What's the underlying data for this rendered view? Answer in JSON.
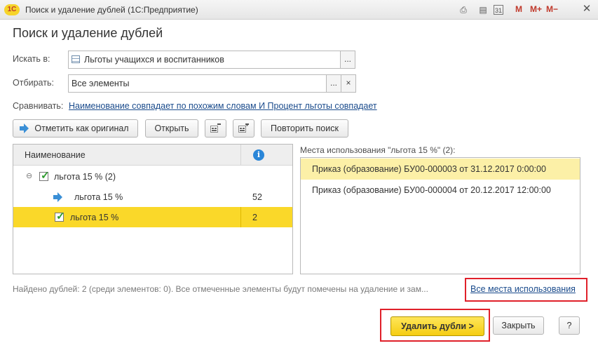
{
  "window": {
    "title": "Поиск и удаление дублей  (1С:Предприятие)",
    "logo_text": "1С"
  },
  "titlebar_tools": {
    "m": "M",
    "m_plus": "M+",
    "m_minus": "M−",
    "calendar": "31",
    "close": "✕"
  },
  "heading": "Поиск и удаление дублей",
  "search_in": {
    "label": "Искать в:",
    "value": "Льготы учащихся и воспитанников",
    "btn": "..."
  },
  "filter": {
    "label": "Отбирать:",
    "value": "Все элементы",
    "btn": "...",
    "clear": "×"
  },
  "compare": {
    "label": "Сравнивать:",
    "link": "Наименование совпадает по похожим словам И Процент льготы совпадает"
  },
  "toolbar": {
    "mark_original": "Отметить как оригинал",
    "open": "Открыть",
    "repeat_search": "Повторить поиск"
  },
  "duplicates_grid": {
    "col_name": "Наименование",
    "info_glyph": "i",
    "group": {
      "toggle": "⊖",
      "label": "льгота 15 % (2)"
    },
    "rows": [
      {
        "name": "льгота 15 %",
        "count": "52"
      },
      {
        "name": "льгота 15 %",
        "count": "2"
      }
    ]
  },
  "usage": {
    "title": "Места использования \"льгота 15 %\" (2):",
    "rows": [
      "Приказ (образование) БУ00-000003 от 31.12.2017 0:00:00",
      "Приказ (образование) БУ00-000004 от 20.12.2017 12:00:00"
    ]
  },
  "footer": {
    "status": "Найдено дублей: 2 (среди элементов: 0). Все отмеченные элементы будут помечены на удаление и зам...",
    "all_usages_link": "Все места использования"
  },
  "actions": {
    "delete": "Удалить дубли >",
    "close": "Закрыть",
    "help": "?"
  },
  "colors": {
    "accent": "#fad829",
    "link": "#1a4b8c",
    "highlight_row": "#fcf0a7",
    "annotation": "#e0202a"
  }
}
